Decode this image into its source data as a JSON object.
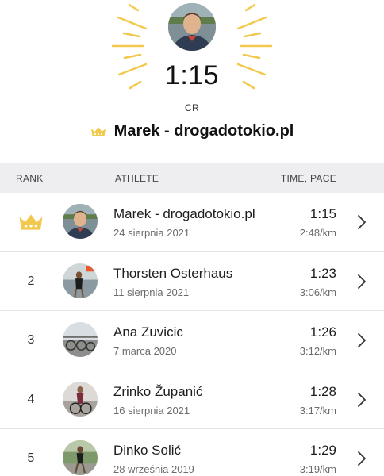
{
  "hero": {
    "time": "1:15",
    "label": "CR",
    "holder_name": "Marek - drogadotokio.pl",
    "accent_color": "#f2c94c",
    "icons": {
      "avatar": "athlete-photo",
      "crown": "crown-icon"
    }
  },
  "table": {
    "headers": {
      "rank": "RANK",
      "athlete": "ATHLETE",
      "time_pace": "TIME, PACE"
    },
    "rows": [
      {
        "rank": "",
        "rank_icon": "crown-icon",
        "name": "Marek - drogadotokio.pl",
        "date": "24 sierpnia 2021",
        "time": "1:15",
        "pace": "2:48/km"
      },
      {
        "rank": "2",
        "name": "Thorsten Osterhaus",
        "date": "11 sierpnia 2021",
        "time": "1:23",
        "pace": "3:06/km"
      },
      {
        "rank": "3",
        "name": "Ana Zuvicic",
        "date": "7 marca 2020",
        "time": "1:26",
        "pace": "3:12/km"
      },
      {
        "rank": "4",
        "name": "Zrinko Županić",
        "date": "16 sierpnia 2021",
        "time": "1:28",
        "pace": "3:17/km"
      },
      {
        "rank": "5",
        "name": "Dinko Solić",
        "date": "28 września 2019",
        "time": "1:29",
        "pace": "3:19/km"
      }
    ]
  }
}
